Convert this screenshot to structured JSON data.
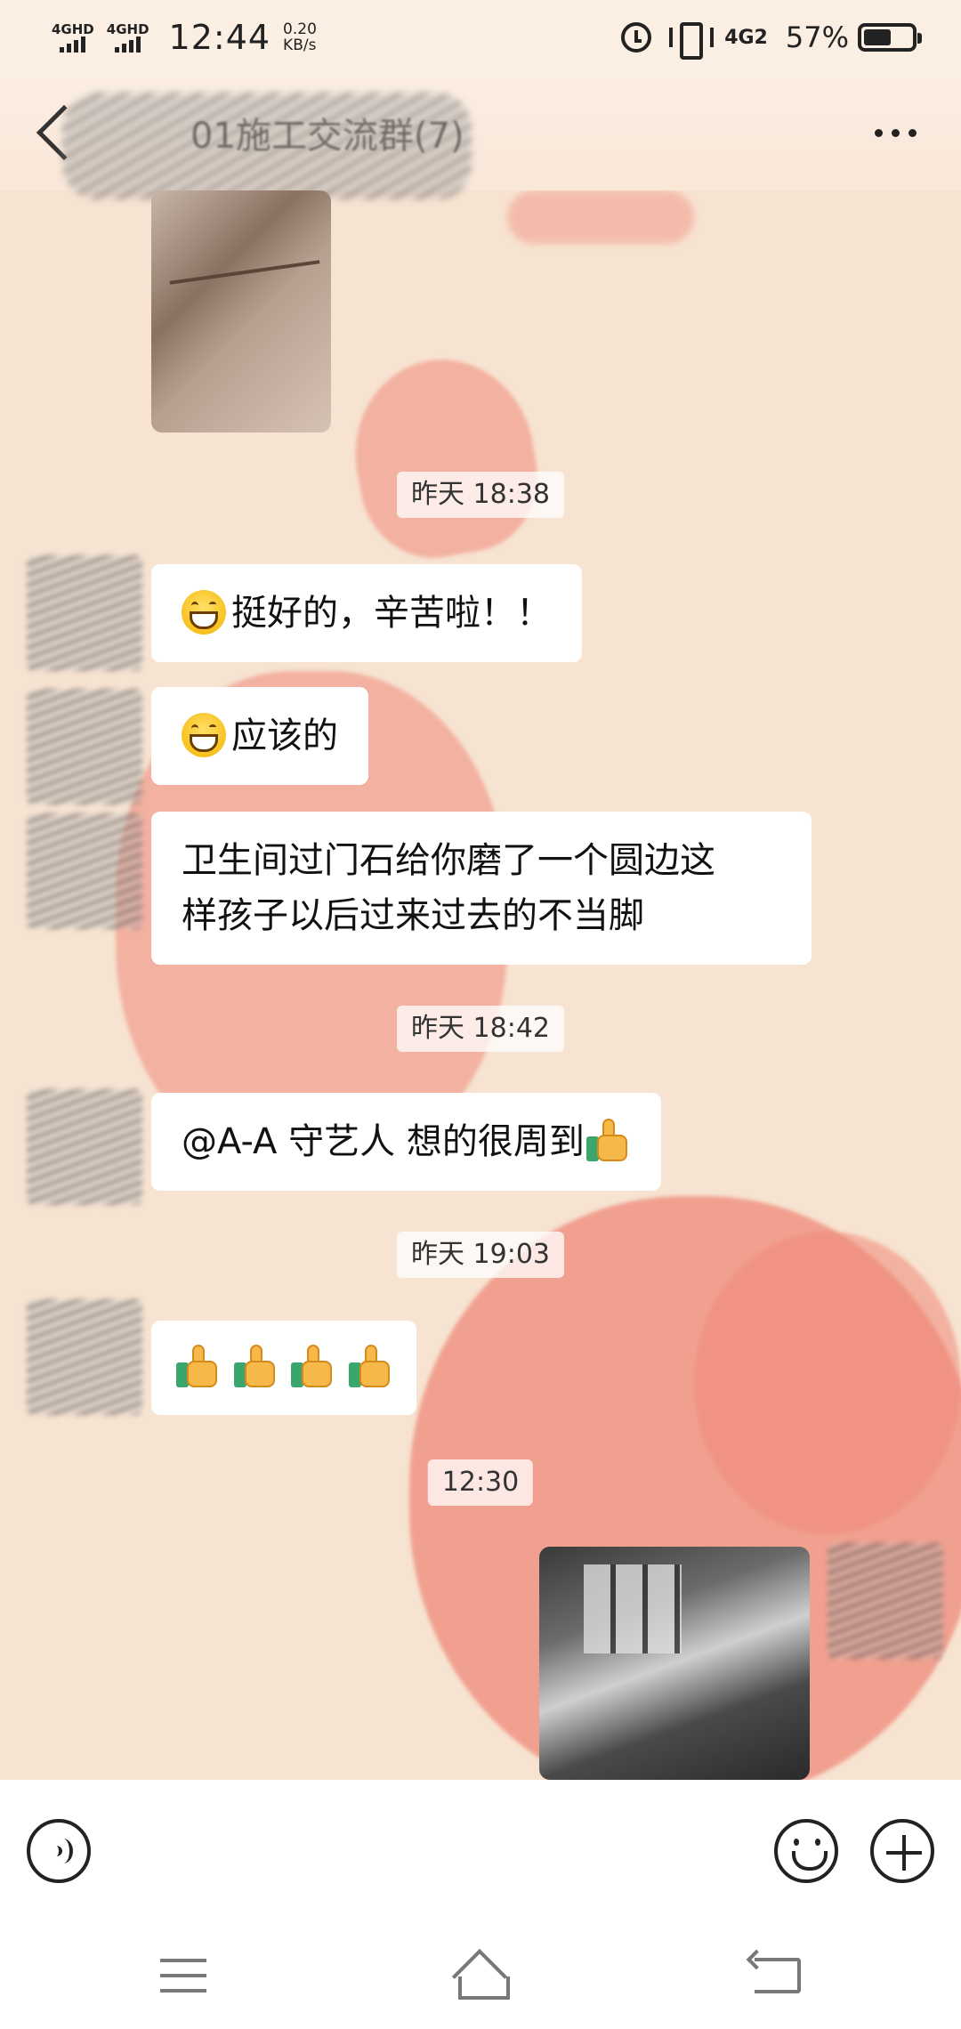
{
  "status_bar": {
    "sim1": "4GHD",
    "sim2": "4GHD",
    "time": "12:44",
    "speed_value": "0.20",
    "speed_unit": "KB/s",
    "network": "4G2",
    "battery_percent": "57%",
    "battery_level": 0.57
  },
  "header": {
    "title": "01施工交流群(7)"
  },
  "messages": {
    "ts1": "昨天 18:38",
    "m1_text": "挺好的，辛苦啦！！",
    "m2_text": "应该的",
    "m3_line1": "卫生间过门石给你磨了一个圆边这",
    "m3_line2": "样孩子以后过来过去的不当脚",
    "ts2": "昨天 18:42",
    "m4_text": "@A-A 守艺人  想的很周到",
    "ts3": "昨天 19:03",
    "ts4": "12:30"
  },
  "icons": {
    "grin": "grinning-face-emoji",
    "thumbs": "thumbs-up-emoji"
  }
}
